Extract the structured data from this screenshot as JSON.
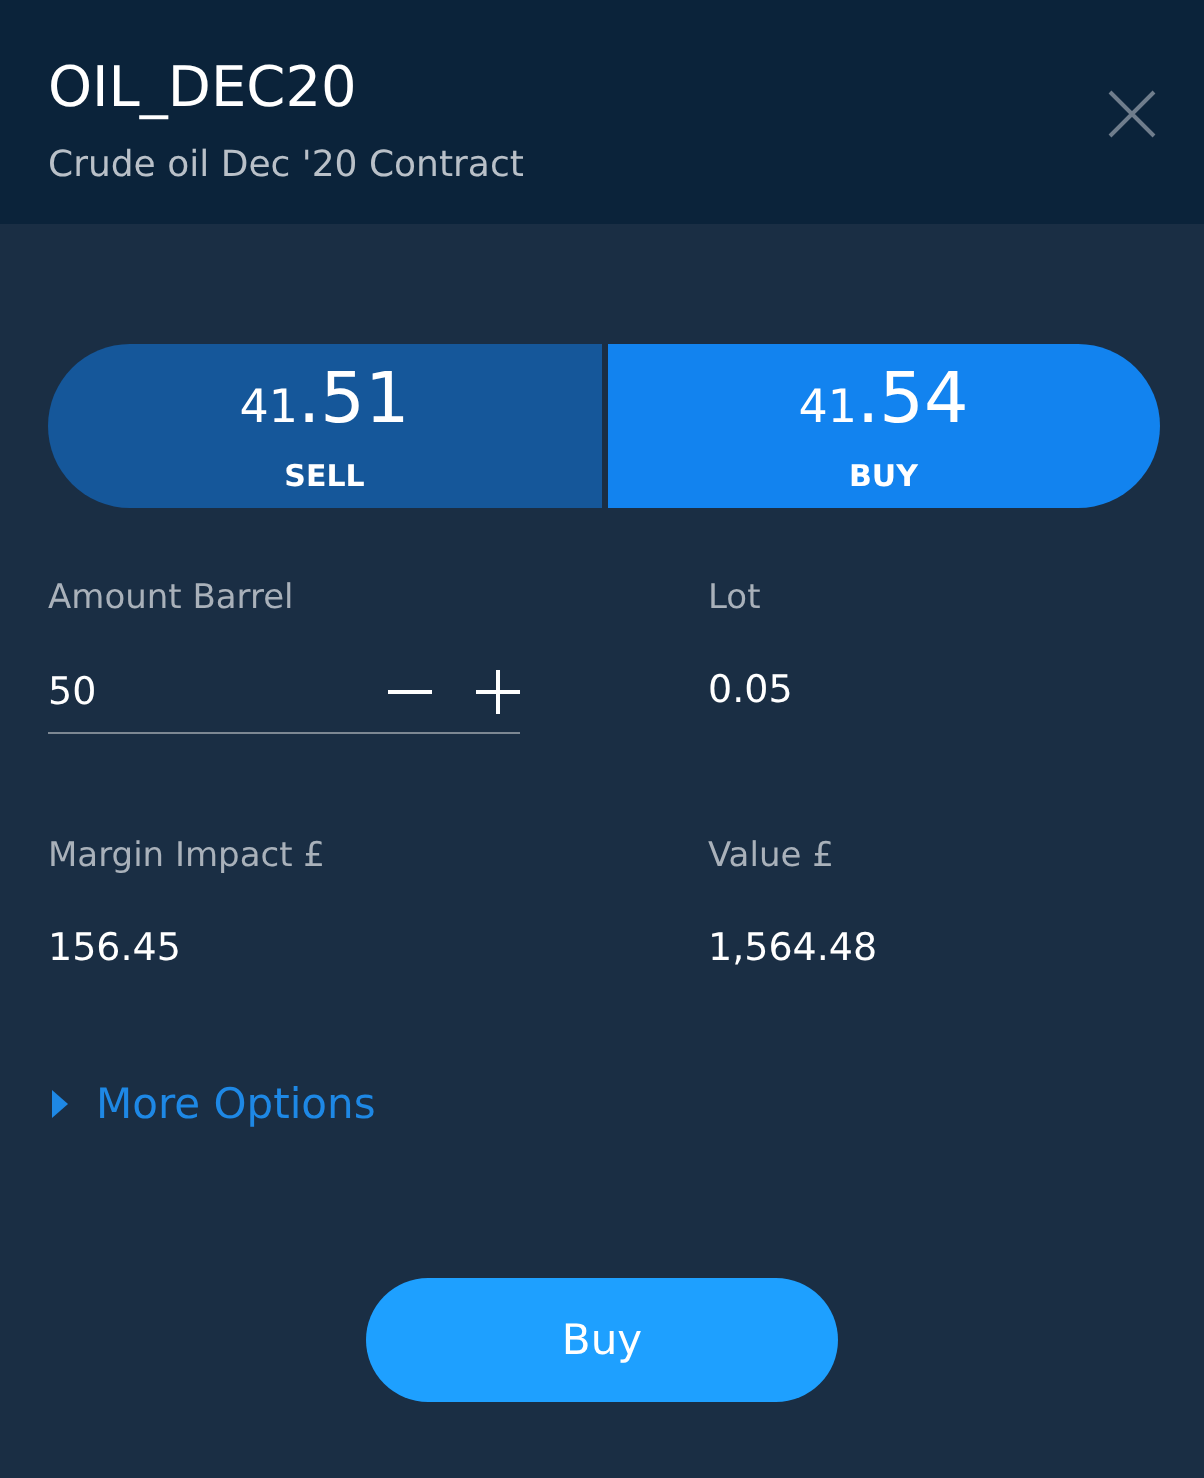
{
  "header": {
    "title": "OIL_DEC20",
    "subtitle": "Crude oil Dec '20 Contract"
  },
  "sides": [
    {
      "kind": "sell",
      "price_small": "41",
      "price_large": ".51",
      "label": "SELL",
      "selected": false
    },
    {
      "kind": "buy",
      "price_small": "41",
      "price_large": ".54",
      "label": "BUY",
      "selected": true
    }
  ],
  "fields": [
    {
      "kind": "stepper",
      "label": "Amount Barrel",
      "value": "50"
    },
    {
      "kind": "readout",
      "label": "Lot",
      "value": "0.05"
    },
    {
      "kind": "readout",
      "label": "Margin Impact £",
      "value": "156.45"
    },
    {
      "kind": "readout",
      "label": "Value £",
      "value": "1,564.48"
    }
  ],
  "more_options": {
    "label": "More Options",
    "expanded": false
  },
  "submit": {
    "label": "Buy"
  }
}
